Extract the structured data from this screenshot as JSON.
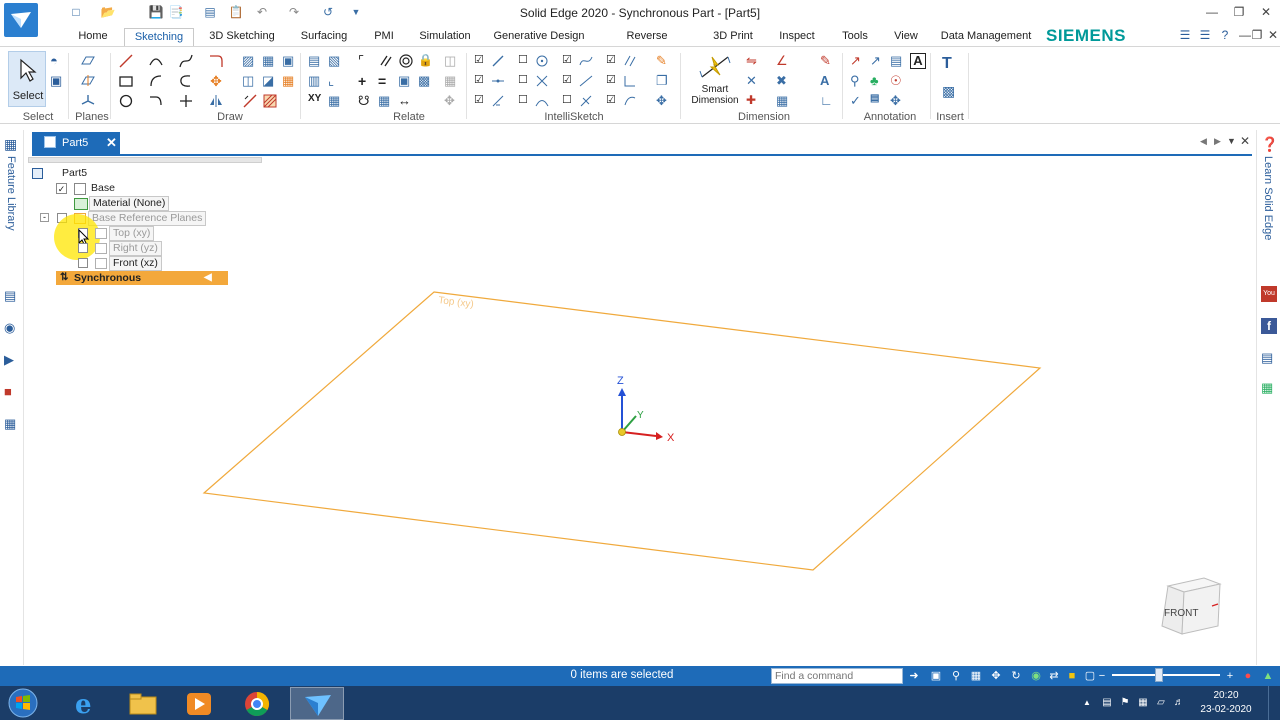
{
  "window": {
    "title": "Solid Edge 2020 - Synchronous Part - [Part5]"
  },
  "menu": {
    "tabs": [
      "Home",
      "Sketching",
      "3D Sketching",
      "Surfacing",
      "PMI",
      "Simulation",
      "Generative Design",
      "Reverse Engineering",
      "3D Print",
      "Inspect",
      "Tools",
      "View",
      "Data Management"
    ],
    "active": "Sketching",
    "brand": "SIEMENS"
  },
  "ribbon": {
    "select_label": "Select",
    "smart_dimension": [
      "Smart",
      "Dimension"
    ],
    "groups": [
      "Select",
      "Planes",
      "Draw",
      "Relate",
      "IntelliSketch",
      "Dimension",
      "Annotation",
      "Insert"
    ]
  },
  "sidebars": {
    "left_label": "Feature Library",
    "right_label": "Learn Solid Edge"
  },
  "document": {
    "tab_name": "Part5"
  },
  "tree": {
    "root": "Part5",
    "base": "Base",
    "material": "Material (None)",
    "ref_planes": "Base Reference Planes",
    "top": "Top (xy)",
    "right": "Right (yz)",
    "front": "Front (xz)",
    "synchronous": "Synchronous"
  },
  "viewport": {
    "plane_label": "Top (xy)",
    "axis_z": "Z",
    "axis_y": "Y",
    "axis_x": "X",
    "view_cube_face": "FRONT",
    "plane_color": "#f0a93c"
  },
  "status": {
    "selection": "0 items are selected",
    "find_placeholder": "Find a command"
  },
  "taskbar": {
    "time": "20:20",
    "date": "23-02-2020"
  }
}
